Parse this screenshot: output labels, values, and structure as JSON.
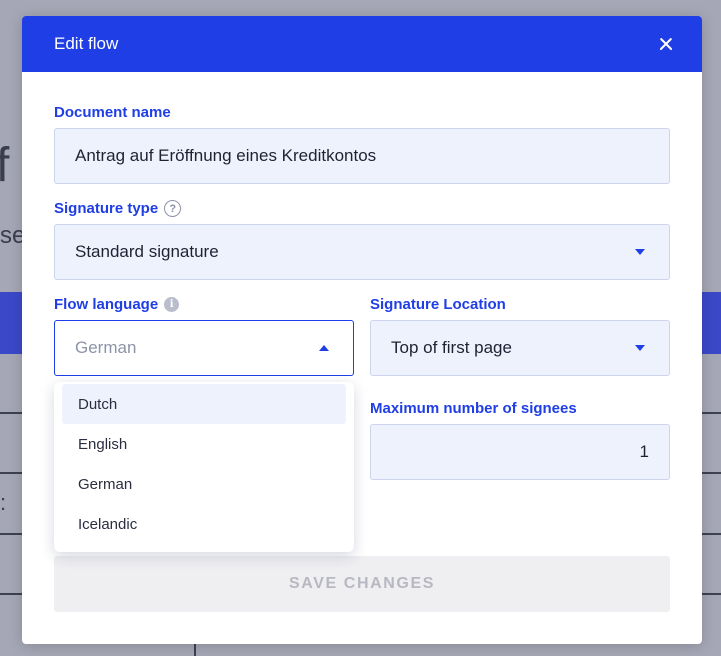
{
  "background": {
    "heading_fragment": "f r",
    "sub_fragment": "se",
    "colon_fragment": ":"
  },
  "modal": {
    "title": "Edit flow",
    "close_icon": "close-icon"
  },
  "document_name": {
    "label": "Document name",
    "value": "Antrag auf Eröffnung eines Kreditkontos"
  },
  "signature_type": {
    "label": "Signature type",
    "help_icon": "question-circle-icon",
    "help_glyph": "?",
    "value": "Standard signature"
  },
  "flow_language": {
    "label": "Flow language",
    "info_icon": "info-icon",
    "info_glyph": "i",
    "value": "German",
    "options": [
      "Dutch",
      "English",
      "German",
      "Icelandic"
    ],
    "highlighted_option": "Dutch"
  },
  "signature_location": {
    "label": "Signature Location",
    "value": "Top of first page"
  },
  "max_signees": {
    "label": "Maximum number of signees",
    "value": "1"
  },
  "save_button": {
    "label": "SAVE CHANGES"
  },
  "colors": {
    "primary": "#1f3ee5",
    "field_bg": "#eef2fd",
    "overlay": "#a5a7b6",
    "disabled_text": "#b7b8c2"
  }
}
